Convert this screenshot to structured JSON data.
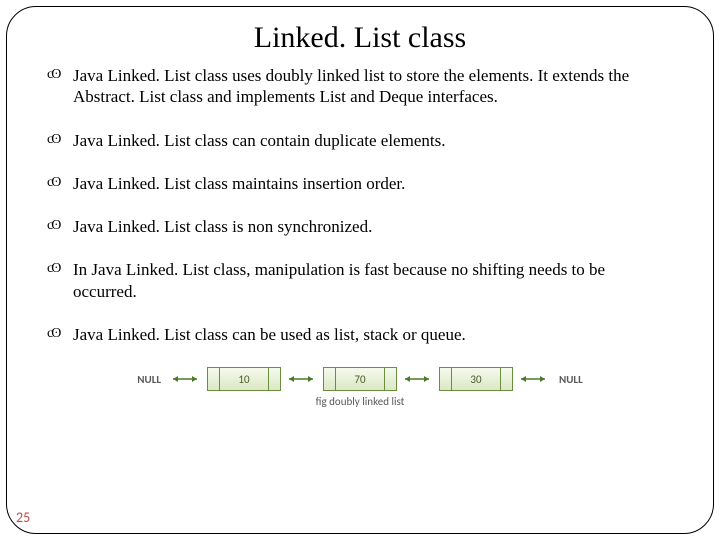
{
  "title": "Linked. List class",
  "bullets": [
    "Java Linked. List class uses doubly linked list to store the elements. It extends the Abstract. List class and implements List and Deque interfaces.",
    "Java Linked. List class can contain duplicate elements.",
    "Java Linked. List class maintains insertion order.",
    "Java Linked. List class is non synchronized.",
    "In Java Linked. List class, manipulation is fast because no shifting needs to be occurred.",
    "Java Linked. List class can be used as list, stack or queue."
  ],
  "diagram": {
    "null_label": "NULL",
    "node_values": [
      "10",
      "70",
      "30"
    ],
    "caption": "fig  doubly linked list"
  },
  "page_number": "25",
  "bullet_glyph": "cʘ"
}
